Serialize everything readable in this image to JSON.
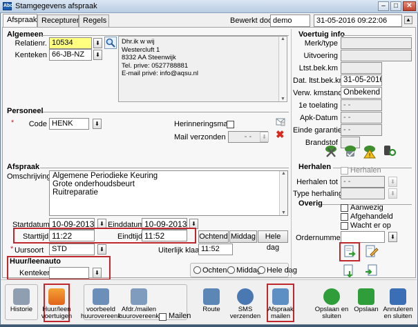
{
  "window": {
    "title": "Stamgegevens afspraak",
    "app_icon": "Abc",
    "min": "–",
    "max": "□",
    "close": "✕"
  },
  "tabs": [
    "Afspraak",
    "Recepturen",
    "Regels"
  ],
  "header": {
    "bewerkt_label": "Bewerkt door",
    "bewerkt_value": "demo",
    "datetime": "31-05-2016 09:22:06"
  },
  "algemeen": {
    "title": "Algemeen",
    "relatienr_label": "Relatienr.",
    "relatienr": "10534",
    "kenteken_label": "Kenteken",
    "kenteken": "66-JB-NZ",
    "address": [
      "Dhr.ik w wij",
      "Westercluft 1",
      "8332 AA  Steenwijk",
      "Tel. prive: 0527788881",
      "E-mail privé: info@aqsu.nl"
    ]
  },
  "personeel": {
    "title": "Personeel",
    "code_label": "Code",
    "required_mark": "*",
    "code": "HENK",
    "herinnering_label": "Herinneringsmail",
    "mail_verzonden_label": "Mail verzonden",
    "mail_verzonden_value": "-  -"
  },
  "afspraak": {
    "title": "Afspraak",
    "omschrijving_label": "Omschrijving",
    "omschrijving_lines": [
      "Algemene Periodieke Keuring",
      "Grote onderhoudsbeurt",
      "Ruitreparatie"
    ],
    "startdatum_label": "Startdatum",
    "startdatum": "10-09-2013",
    "einddatum_label": "Einddatum",
    "einddatum": "10-09-2013",
    "starttijd_label": "Starttijd",
    "starttijd": "11:22",
    "eindtijd_label": "Eindtijd",
    "eindtijd": "11:52",
    "btn_ochtend": "Ochtend",
    "btn_middag": "Middag",
    "btn_heledag": "Hele dag",
    "uursoort_label": "Uursoort",
    "uursoort": "STD",
    "uiterlijk_label": "Uiterlijk klaar",
    "uiterlijk": "11:52"
  },
  "huurauto": {
    "title": "Huur/leenauto",
    "kenteken_label": "Kenteken",
    "kenteken": "",
    "radio_ochtend": "Ochtend",
    "radio_middag": "Middag",
    "radio_heledag": "Hele dag"
  },
  "voertuig": {
    "title": "Voertuig info",
    "rows": [
      {
        "label": "Merk/type",
        "value": ""
      },
      {
        "label": "Uitvoering",
        "value": ""
      },
      {
        "label": "Ltst.bek.km",
        "value": ""
      },
      {
        "label": "Dat. ltst.bek.km",
        "value": "31-05-2016"
      },
      {
        "label": "Verw. kmstand",
        "value": "Onbekend"
      },
      {
        "label": "1e toelating",
        "value": "-  -"
      },
      {
        "label": "Apk-Datum",
        "value": "-  -"
      },
      {
        "label": "Einde garantie",
        "value": "-  -"
      },
      {
        "label": "Brandstof",
        "value": ""
      }
    ]
  },
  "herhalen": {
    "title": "Herhalen",
    "checkbox_label": "Herhalen",
    "tot_label": "Herhalen tot",
    "tot_value": "-  -",
    "type_label": "Type herhaling",
    "type_value": ""
  },
  "overig": {
    "title": "Overig",
    "checks": [
      "Aanwezig",
      "Afgehandeld",
      "Wacht er op"
    ],
    "ordernummer_label": "Ordernummer",
    "ordernummer": ""
  },
  "toolbar": {
    "historie": "Historie",
    "huur": [
      "Huur/leen",
      "voertuigen"
    ],
    "voorbeeld": [
      "voorbeeld",
      "huurovereenk."
    ],
    "afdr": [
      "Afdr./mailen",
      "huurovereenk."
    ],
    "mailen_check": "Mailen",
    "route": "Route",
    "sms": [
      "SMS",
      "verzenden"
    ],
    "afspraak_mailen": [
      "Afspraak",
      "mailen"
    ],
    "opslaan_sluiten": [
      "Opslaan en",
      "sluiten"
    ],
    "opslaan": "Opslaan",
    "annuleren": [
      "Annuleren",
      "en sluiten"
    ]
  },
  "colors": {
    "highlight_border": "#c0272d",
    "yellow_field": "#ffff80",
    "titlebar": "#b9cde3"
  }
}
